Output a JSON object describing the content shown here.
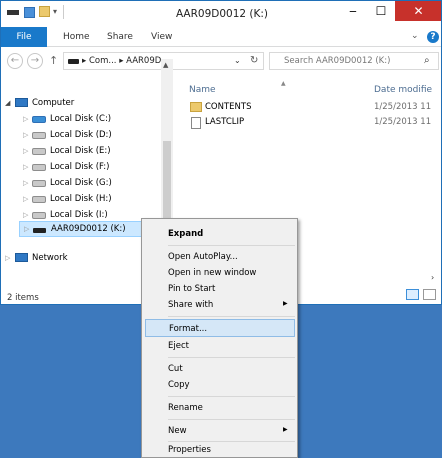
{
  "window": {
    "title": "AAR09D0012 (K:)"
  },
  "ribbon": {
    "tabs": [
      "File",
      "Home",
      "Share",
      "View"
    ]
  },
  "nav": {
    "back": "←",
    "forward": "→",
    "up": "↑",
    "address": "▸ Com... ▸ AAR09D...",
    "search_placeholder": "Search AAR09D0012 (K:)"
  },
  "tree": {
    "computer": "Computer",
    "drives": [
      "Local Disk (C:)",
      "Local Disk (D:)",
      "Local Disk (E:)",
      "Local Disk (F:)",
      "Local Disk (G:)",
      "Local Disk (H:)",
      "Local Disk (I:)"
    ],
    "selected": "AAR09D0012 (K:)",
    "network": "Network"
  },
  "files": {
    "columns": {
      "name": "Name",
      "date": "Date modifie"
    },
    "items": [
      {
        "name": "CONTENTS",
        "date": "1/25/2013 11",
        "kind": "folder"
      },
      {
        "name": "LASTCLIP",
        "date": "1/25/2013 11",
        "kind": "file"
      }
    ]
  },
  "status": {
    "count": "2 items"
  },
  "context_menu": {
    "expand": "Expand",
    "open_autoplay": "Open AutoPlay...",
    "open_new_window": "Open in new window",
    "pin_to_start": "Pin to Start",
    "share_with": "Share with",
    "format": "Format...",
    "eject": "Eject",
    "cut": "Cut",
    "copy": "Copy",
    "rename": "Rename",
    "new": "New",
    "properties": "Properties"
  },
  "colors": {
    "accent": "#1979ca",
    "desktop": "#3d79bd",
    "close": "#c7312b"
  }
}
